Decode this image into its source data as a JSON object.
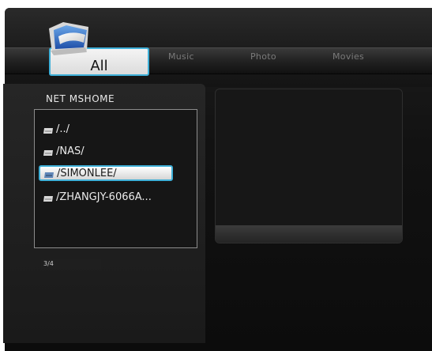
{
  "tabs": {
    "active": "All",
    "music": "Music",
    "photo": "Photo",
    "movies": "Movies"
  },
  "sidebar": {
    "title": "NET  MSHOME",
    "items": [
      {
        "label": "/../",
        "icon": "network-drive-icon"
      },
      {
        "label": "/NAS/",
        "icon": "network-drive-icon"
      },
      {
        "label": "/SIMONLEE/",
        "icon": "network-drive-icon",
        "selected": true
      },
      {
        "label": "/ZHANGJY-6066A...",
        "icon": "network-drive-icon"
      }
    ],
    "page_indicator": "3/4"
  },
  "colors": {
    "accent": "#3fb0d8",
    "background": "#121212",
    "text": "#ececec"
  }
}
